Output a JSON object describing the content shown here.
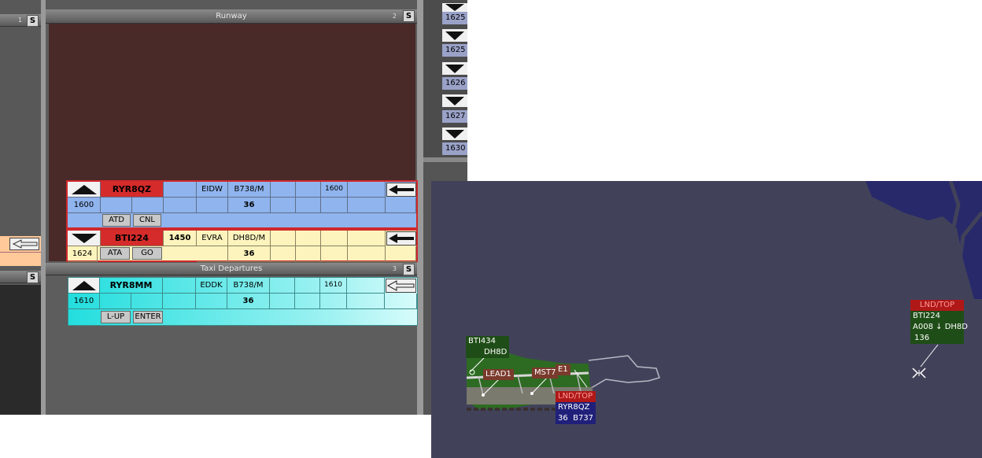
{
  "left_panel": {
    "btn_top": "S",
    "num_top": "1",
    "btn_mid": "S"
  },
  "runway_panel": {
    "title": "Runway",
    "num": "2",
    "button": "S"
  },
  "taxi_panel": {
    "title": "Taxi Departures",
    "num": "3",
    "button": "S"
  },
  "strips": [
    {
      "callsign": "RYR8QZ",
      "time_top": "",
      "dest": "EIDW",
      "type": "B738/M",
      "slot": "1600",
      "time_bottom": "1600",
      "runway": "36",
      "btn1": "ATD",
      "btn2": "CNL"
    },
    {
      "callsign": "BTI224",
      "time_top": "1450",
      "dest": "EVRA",
      "type": "DH8D/M",
      "slot": "",
      "time_bottom": "1624",
      "runway": "36",
      "btn1": "ATA",
      "btn2": "GO"
    },
    {
      "callsign": "RYR8MM",
      "time_top": "",
      "dest": "EDDK",
      "type": "B738/M",
      "slot": "1610",
      "time_bottom": "1610",
      "runway": "36",
      "btn1": "L-UP",
      "btn2": "ENTER"
    }
  ],
  "queue": [
    "1625",
    "1625",
    "1626",
    "1627",
    "1630"
  ],
  "radar": {
    "labels": {
      "bti434": {
        "callsign": "BTI434",
        "type": "DH8D"
      },
      "lead1": "LEAD1",
      "mst": "MST7",
      "e1": "E1",
      "ryr_state": "LND/TOP",
      "ryr_callsign": "RYR8QZ",
      "ryr_runway": "36",
      "ryr_type": "B737",
      "bti_state": "LND/TOP",
      "bti_callsign": "BTI224",
      "bti_alt": "A008",
      "bti_trend": "↓",
      "bti_type": "DH8D",
      "bti_speed": "136"
    }
  }
}
